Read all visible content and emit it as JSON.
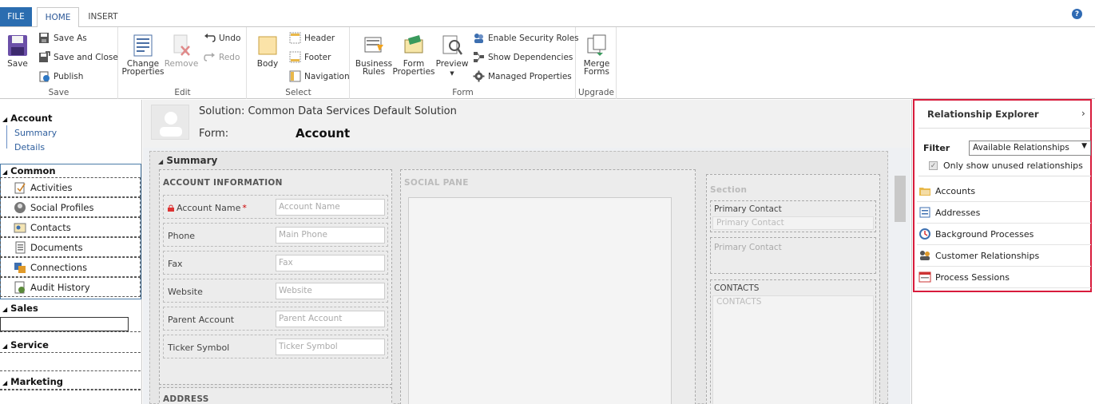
{
  "tabs": {
    "file": "FILE",
    "home": "HOME",
    "insert": "INSERT"
  },
  "help": "?",
  "ribbon": {
    "save_group": {
      "label": "Save",
      "save": "Save",
      "save_as": "Save As",
      "save_close": "Save and Close",
      "publish": "Publish"
    },
    "edit_group": {
      "label": "Edit",
      "change_properties_1": "Change",
      "change_properties_2": "Properties",
      "remove": "Remove",
      "undo": "Undo",
      "redo": "Redo"
    },
    "select_group": {
      "label": "Select",
      "body": "Body",
      "header": "Header",
      "footer": "Footer",
      "navigation": "Navigation"
    },
    "form_group": {
      "label": "Form",
      "business_rules_1": "Business",
      "business_rules_2": "Rules",
      "form_properties_1": "Form",
      "form_properties_2": "Properties",
      "preview": "Preview",
      "enable_security_roles": "Enable Security Roles",
      "show_dependencies": "Show Dependencies",
      "managed_properties": "Managed Properties"
    },
    "upgrade_group": {
      "label": "Upgrade",
      "merge_forms_1": "Merge",
      "merge_forms_2": "Forms"
    }
  },
  "leftnav": {
    "account": "Account",
    "summary": "Summary",
    "details": "Details",
    "common": "Common",
    "common_items": [
      "Activities",
      "Social Profiles",
      "Contacts",
      "Documents",
      "Connections",
      "Audit History"
    ],
    "sales": "Sales",
    "service": "Service",
    "marketing": "Marketing"
  },
  "header": {
    "solution": "Solution: Common Data Services Default Solution",
    "form_label": "Form:",
    "form_name": "Account"
  },
  "form": {
    "tab_title": "Summary",
    "account_info": {
      "title": "ACCOUNT INFORMATION",
      "fields": [
        {
          "label": "Account Name",
          "placeholder": "Account Name",
          "required": "*"
        },
        {
          "label": "Phone",
          "placeholder": "Main Phone"
        },
        {
          "label": "Fax",
          "placeholder": "Fax"
        },
        {
          "label": "Website",
          "placeholder": "Website"
        },
        {
          "label": "Parent Account",
          "placeholder": "Parent Account"
        },
        {
          "label": "Ticker Symbol",
          "placeholder": "Ticker Symbol"
        }
      ]
    },
    "address_title": "ADDRESS",
    "social_pane": "SOCIAL PANE",
    "right_section": {
      "title": "Section",
      "primary_contact_label": "Primary Contact",
      "primary_contact_placeholder": "Primary Contact",
      "primary_contact_2": "Primary Contact",
      "contacts_label": "CONTACTS",
      "contacts_placeholder": "CONTACTS"
    }
  },
  "relationship_explorer": {
    "title": "Relationship Explorer",
    "collapse": "›",
    "filter_label": "Filter",
    "filter_value": "Available Relationships",
    "only_unused": "Only show unused relationships",
    "items": [
      "Accounts",
      "Addresses",
      "Background Processes",
      "Customer Relationships",
      "Process Sessions"
    ],
    "highlight_color": "#d81b3c"
  }
}
